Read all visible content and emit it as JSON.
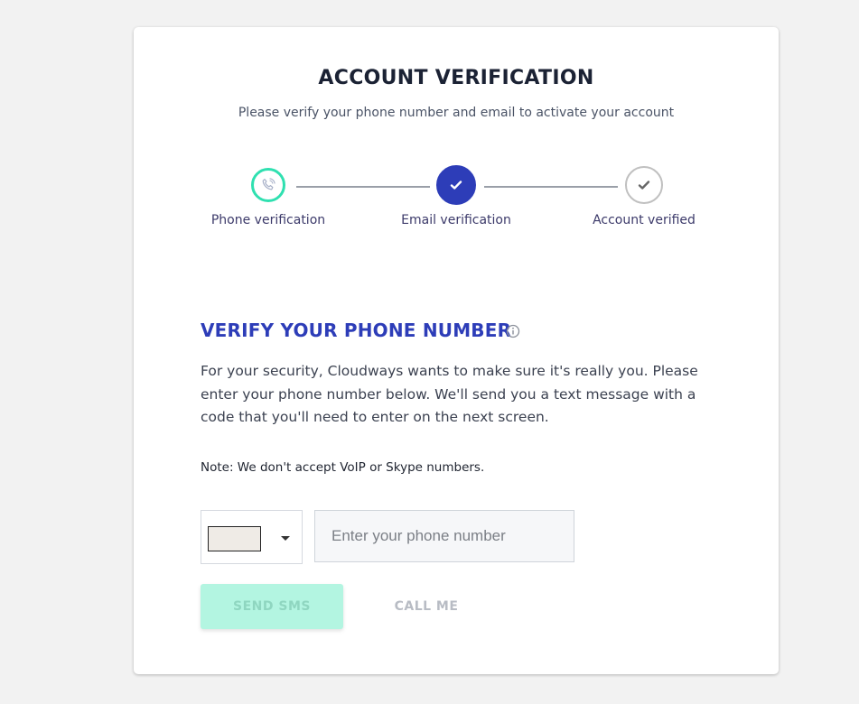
{
  "header": {
    "title": "ACCOUNT VERIFICATION",
    "subtitle": "Please verify your phone number and email to activate your account"
  },
  "steps": [
    {
      "label": "Phone verification",
      "icon": "phone-icon",
      "state": "active",
      "color": "#2fe0b0"
    },
    {
      "label": "Email verification",
      "icon": "check-icon",
      "state": "completed",
      "color": "#2d3db8"
    },
    {
      "label": "Account verified",
      "icon": "check-icon",
      "state": "pending",
      "color": "#c0c0c0"
    }
  ],
  "section": {
    "title": "VERIFY YOUR PHONE NUMBER",
    "info_icon": "info-icon",
    "description": "For your security, Cloudways wants to make sure it's really you. Please enter your phone number below. We'll send you a text message with a code that you'll need to enter on the next screen.",
    "note": "Note: We don't accept VoIP or Skype numbers."
  },
  "form": {
    "phone_placeholder": "Enter your phone number",
    "phone_value": "",
    "country_caret_icon": "caret-down-icon"
  },
  "actions": {
    "send_sms_label": "SEND SMS",
    "call_me_label": "CALL ME"
  },
  "colors": {
    "accent": "#2d3db8",
    "success": "#2fe0b0",
    "send_button_bg": "#b3f5e1"
  }
}
